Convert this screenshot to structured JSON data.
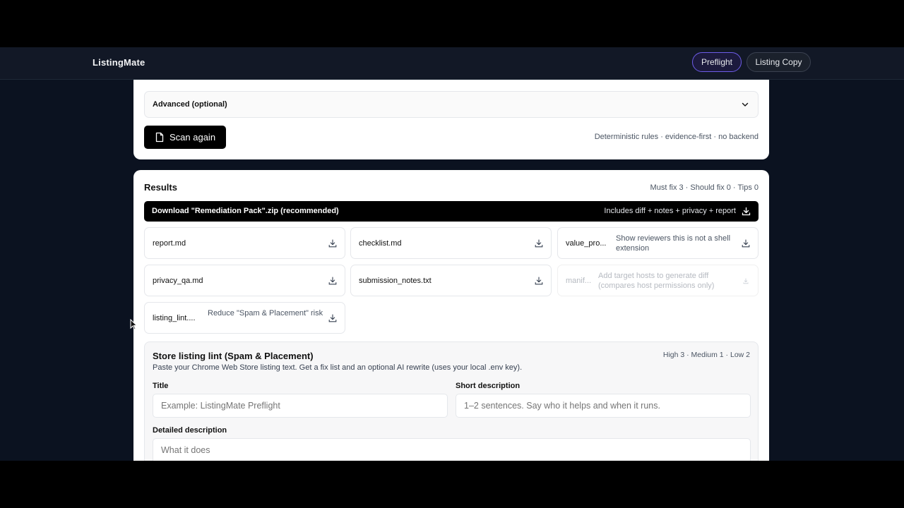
{
  "app": {
    "brand": "ListingMate"
  },
  "nav": {
    "tabs": [
      {
        "label": "Preflight",
        "active": true
      },
      {
        "label": "Listing Copy",
        "active": false
      }
    ]
  },
  "scan": {
    "advanced_label": "Advanced (optional)",
    "button_label": "Scan again",
    "note": "Deterministic rules · evidence-first · no backend"
  },
  "results": {
    "title": "Results",
    "counts": "Must fix 3 · Should fix 0 · Tips 0",
    "download": {
      "label": "Download \"Remediation Pack\".zip (recommended)",
      "meta": "Includes diff + notes + privacy + report"
    },
    "files": [
      {
        "name": "report.md",
        "desc": "",
        "disabled": false
      },
      {
        "name": "checklist.md",
        "desc": "",
        "disabled": false
      },
      {
        "name": "value_pro...",
        "desc": "Show reviewers this is not a shell extension",
        "disabled": false
      },
      {
        "name": "privacy_qa.md",
        "desc": "",
        "disabled": false
      },
      {
        "name": "submission_notes.txt",
        "desc": "",
        "disabled": false
      },
      {
        "name": "manif...",
        "desc": "Add target hosts to generate diff (compares host permissions only)",
        "disabled": true
      },
      {
        "name": "listing_lint....",
        "desc": "Reduce \"Spam & Placement\" risk",
        "disabled": false
      }
    ]
  },
  "lint": {
    "title": "Store listing lint (Spam & Placement)",
    "subtitle": "Paste your Chrome Web Store listing text. Get a fix list and an optional AI rewrite (uses your local .env key).",
    "severity": "High 3 · Medium 1 · Low 2",
    "fields": {
      "title_label": "Title",
      "title_placeholder": "Example: ListingMate Preflight",
      "short_label": "Short description",
      "short_placeholder": "1–2 sentences. Say who it helps and when it runs.",
      "detail_label": "Detailed description",
      "detail_placeholder": "What it does"
    }
  },
  "colors": {
    "accent": "#6d5ce7",
    "page_bg": "#0b1220",
    "primary_button": "#000000"
  }
}
